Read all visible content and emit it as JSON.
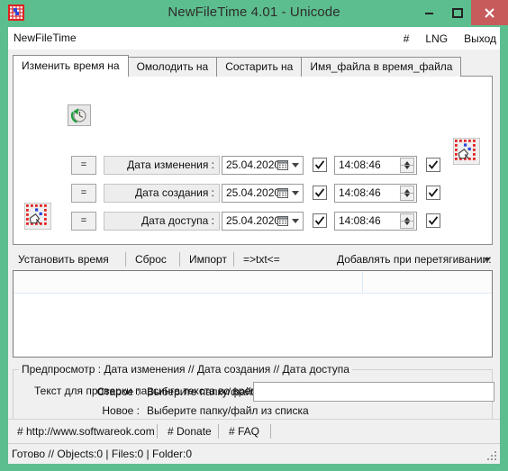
{
  "window": {
    "title": "NewFileTime 4.01 - Unicode",
    "icon": "app-clock-file-icon",
    "controls": {
      "minimize": "minimize-icon",
      "maximize": "maximize-icon",
      "close": "close-icon"
    },
    "accent_color": "#5cbe8e",
    "close_color": "#c75b5b"
  },
  "menubar": {
    "app_name": "NewFileTime",
    "items": [
      {
        "label": "#",
        "name": "hash"
      },
      {
        "label": "LNG",
        "name": "language"
      },
      {
        "label": "Выход",
        "name": "exit"
      }
    ]
  },
  "tabs": [
    {
      "label": "Изменить время на",
      "active": true
    },
    {
      "label": "Омолодить на",
      "active": false
    },
    {
      "label": "Состарить на",
      "active": false
    },
    {
      "label": "Имя_файла в время_файла",
      "active": false
    }
  ],
  "form": {
    "clock_button_icon": "refresh-clock-icon",
    "drag_icon_left": "file-drag-grid-icon",
    "drag_icon_right": "file-drag-grid-icon",
    "equal_label": "=",
    "rows": [
      {
        "name": "modified",
        "label": "Дата изменения :",
        "date": "25.04.2020",
        "date_checked": true,
        "time": "14:08:46",
        "time_checked": true
      },
      {
        "name": "created",
        "label": "Дата создания :",
        "date": "25.04.2020",
        "date_checked": true,
        "time": "14:08:46",
        "time_checked": true
      },
      {
        "name": "accessed",
        "label": "Дата доступа :",
        "date": "25.04.2020",
        "date_checked": true,
        "time": "14:08:46",
        "time_checked": true
      }
    ]
  },
  "toolbar": {
    "set_time": "Установить время",
    "reset": "Сброс",
    "import": "Импорт",
    "txt": "=>txt<=",
    "drag_add": "Добавлять при перетягивании:"
  },
  "listview": {
    "rows": []
  },
  "preview": {
    "legend": "Предпросмотр :   Дата изменения    //   Дата создания    //   Дата доступа",
    "old_label": "Старое :",
    "old_value": "Выберите папку/файл из списка",
    "new_label": "Новое :",
    "new_value": "Выберите папку/файл из списка"
  },
  "parse": {
    "label": "Текст для проверки парсинга текста во время",
    "value": "",
    "placeholder": ""
  },
  "links": [
    {
      "label": "# http://www.softwareok.com",
      "name": "homepage"
    },
    {
      "label": "# Donate",
      "name": "donate"
    },
    {
      "label": "# FAQ",
      "name": "faq"
    }
  ],
  "status": {
    "text": "Готово // Objects:0 | Files:0  | Folder:0"
  }
}
